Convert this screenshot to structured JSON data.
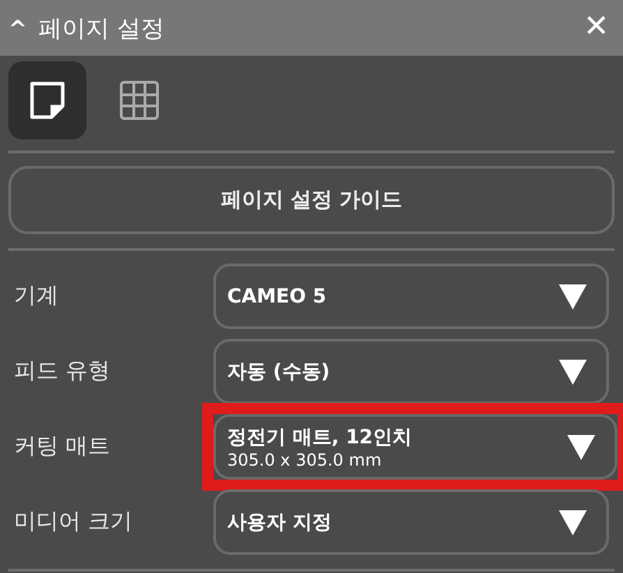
{
  "panel": {
    "title": "페이지 설정",
    "collapse_icon": "^",
    "close_icon": "✕"
  },
  "tabs": [
    {
      "kind": "page",
      "selected": true
    },
    {
      "kind": "grid",
      "selected": false
    }
  ],
  "guide_button": "페이지 설정 가이드",
  "fields": [
    {
      "label": "기계",
      "value": "CAMEO 5",
      "highlighted": false
    },
    {
      "label": "피드 유형",
      "value": "자동 (수동)",
      "highlighted": false
    },
    {
      "label": "커팅 매트",
      "value": "정전기 매트, 12인치",
      "detail": "305.0 x 305.0 mm",
      "highlighted": true
    },
    {
      "label": "미디어 크기",
      "value": "사용자 지정",
      "highlighted": false
    }
  ]
}
